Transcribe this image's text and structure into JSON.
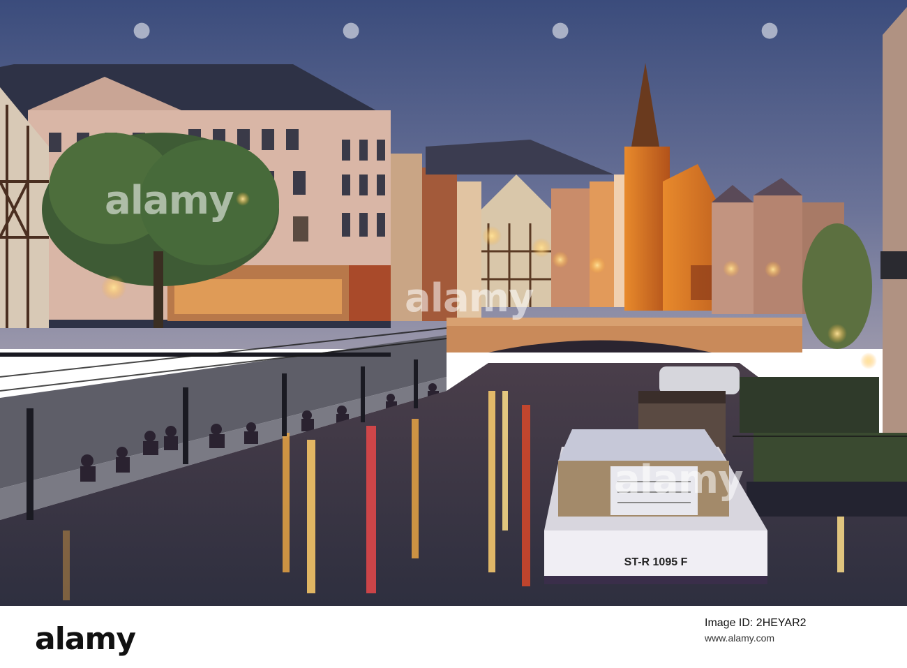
{
  "photo": {
    "boat_plate": "ST-R 1095 F"
  },
  "watermark": {
    "text": "alamy",
    "repeat_count": 3
  },
  "footer": {
    "logo": "alamy",
    "image_id_label": "Image ID: 2HEYAR2",
    "source_url": "www.alamy.com"
  },
  "colors": {
    "sky_top": "#3d4f7e",
    "sky_bottom": "#8e93ae",
    "water": "#3e3a4a",
    "lamp_glow": "#ffc45a",
    "footer_bg": "#ffffff"
  }
}
